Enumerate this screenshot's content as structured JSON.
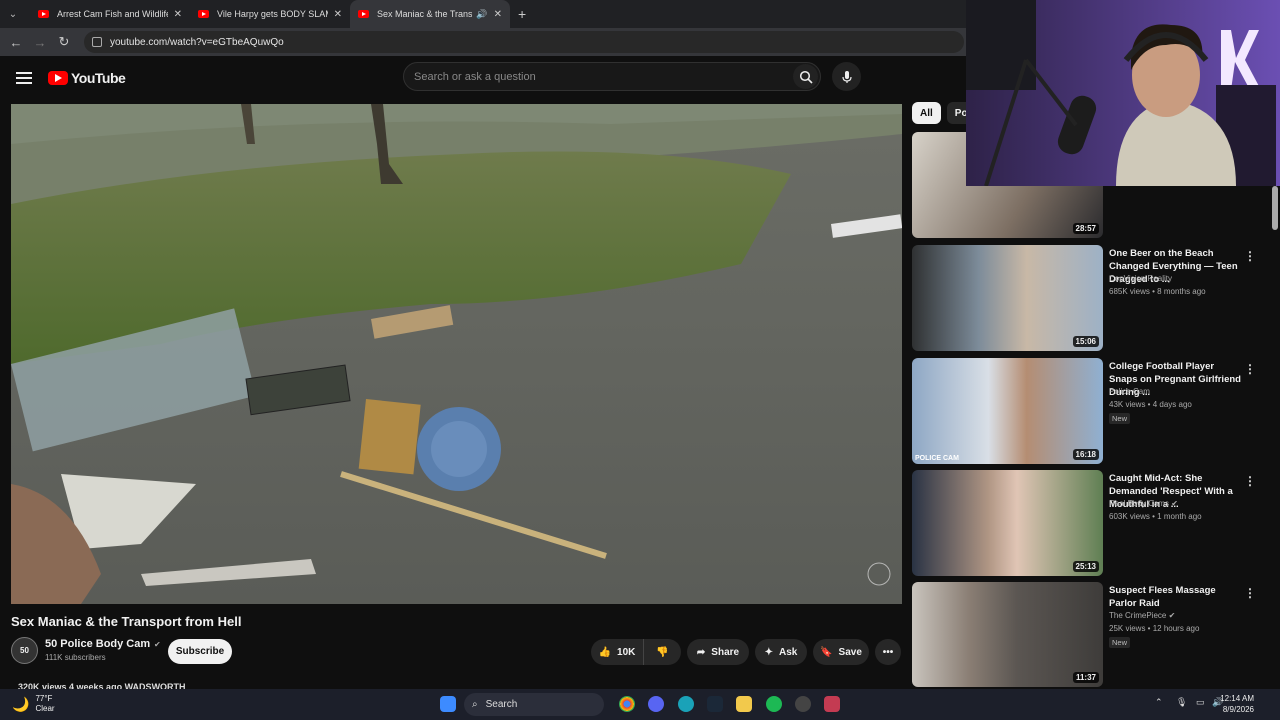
{
  "browser": {
    "tabs": [
      {
        "title": "Arrest Cam Fish and Wildlife - Y"
      },
      {
        "title": "Vile Harpy gets BODY SLAMMI"
      },
      {
        "title": "Sex Maniac & the Transpor",
        "active": true,
        "audio": true
      }
    ],
    "url": "youtube.com/watch?v=eGTbeAQuwQo"
  },
  "youtube": {
    "logo_text": "YouTube",
    "search_placeholder": "Search or ask a question"
  },
  "video": {
    "title": "Sex Maniac & the Transport from Hell",
    "channel_avatar_text": "50",
    "channel_name": "50 Police Body Cam",
    "channel_subs": "111K subscribers",
    "subscribe_label": "Subscribe",
    "like_count": "10K",
    "share_label": "Share",
    "ask_label": "Ask",
    "save_label": "Save",
    "meta": "320K views  4 weeks ago  WADSWORTH"
  },
  "chips": [
    "All",
    "Pol"
  ],
  "recommendations": [
    {
      "title": "",
      "channel": "",
      "views": "",
      "duration": "28:57"
    },
    {
      "title": "One Beer on the Beach Changed Everything — Teen Dragged to ...",
      "channel": "CopVision Reality",
      "views": "685K views • 8 months ago",
      "duration": "15:06",
      "badge": ""
    },
    {
      "title": "College Football Player Snaps on Pregnant Girlfriend During ...",
      "channel": "Police Cam",
      "views": "43K views • 4 days ago",
      "duration": "16:18",
      "badge": "New",
      "thumb_label": "POLICE CAM"
    },
    {
      "title": "Caught Mid-Act: She Demanded 'Respect' With a Mouthful in a ...",
      "channel": "Real Body Cams",
      "views": "603K views • 1 month ago",
      "duration": "25:13",
      "badge": "",
      "verified": true
    },
    {
      "title": "Suspect Flees Massage Parlor Raid",
      "channel": "The CrimePiece",
      "views": "25K views • 12 hours ago",
      "duration": "11:37",
      "badge": "New",
      "verified": true
    }
  ],
  "taskbar": {
    "temp": "77°F",
    "weather": "Clear",
    "search_label": "Search",
    "time": "12:14 AM",
    "date": "8/9/2026"
  }
}
